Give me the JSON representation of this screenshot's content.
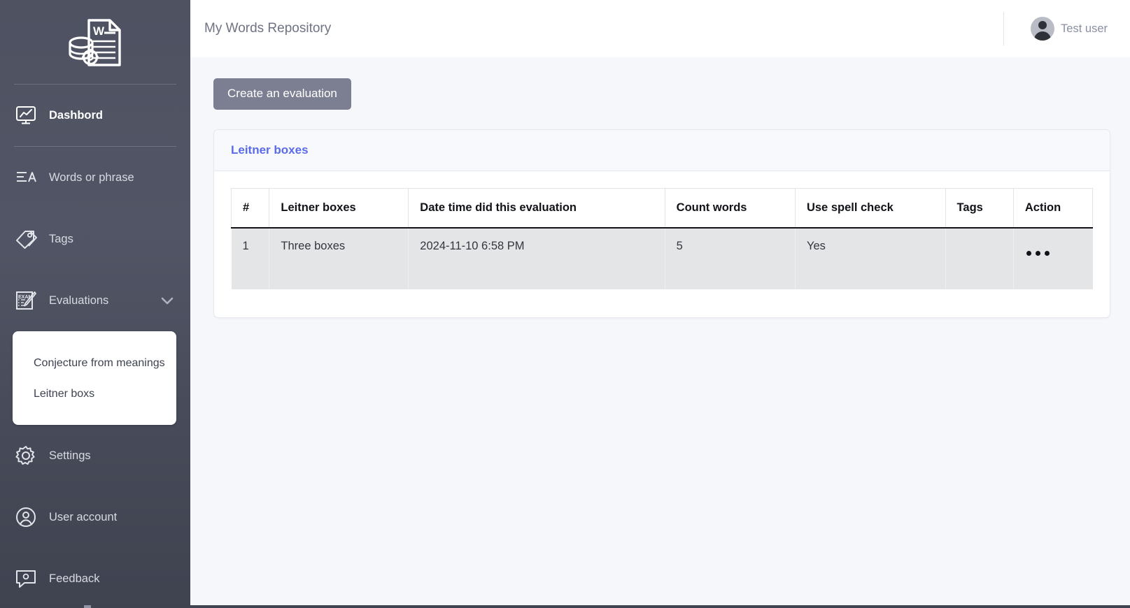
{
  "app": {
    "logo_icon": "document-database-gear-logo"
  },
  "header": {
    "title": "My Words Repository",
    "user_name": "Test user",
    "avatar_icon": "user-avatar-icon"
  },
  "sidebar": {
    "items": [
      {
        "label": "Dashbord",
        "icon": "monitor-chart-icon",
        "active": true
      },
      {
        "label": "Words or phrase",
        "icon": "text-lines-a-icon",
        "active": false
      },
      {
        "label": "Tags",
        "icon": "tags-icon",
        "active": false
      },
      {
        "label": "Evaluations",
        "icon": "exam-pencil-icon",
        "active": false,
        "expanded": true,
        "chevron": "chevron-down-icon"
      },
      {
        "label": "Settings",
        "icon": "gear-icon",
        "active": false
      },
      {
        "label": "User account",
        "icon": "user-circle-icon",
        "active": false
      },
      {
        "label": "Feedback",
        "icon": "feedback-icon",
        "active": false
      }
    ],
    "submenu": [
      {
        "label": "Conjecture from meanings"
      },
      {
        "label": "Leitner boxs"
      }
    ]
  },
  "main": {
    "create_button": "Create an evaluation",
    "card_title": "Leitner boxes",
    "table": {
      "columns": [
        "#",
        "Leitner boxes",
        "Date time did this evaluation",
        "Count words",
        "Use spell check",
        "Tags",
        "Action"
      ],
      "rows": [
        {
          "num": "1",
          "name": "Three boxes",
          "datetime": "2024-11-10 6:58 PM",
          "count_words": "5",
          "use_spell_check": "Yes",
          "tags": "",
          "action_icon": "ellipsis-icon"
        }
      ]
    }
  },
  "colors": {
    "sidebar_bg": "#4e5261",
    "accent_link": "#5a6bea",
    "button_bg": "#7c7f91",
    "page_bg": "#f6f7fb",
    "row_bg": "#e4e5e7"
  }
}
